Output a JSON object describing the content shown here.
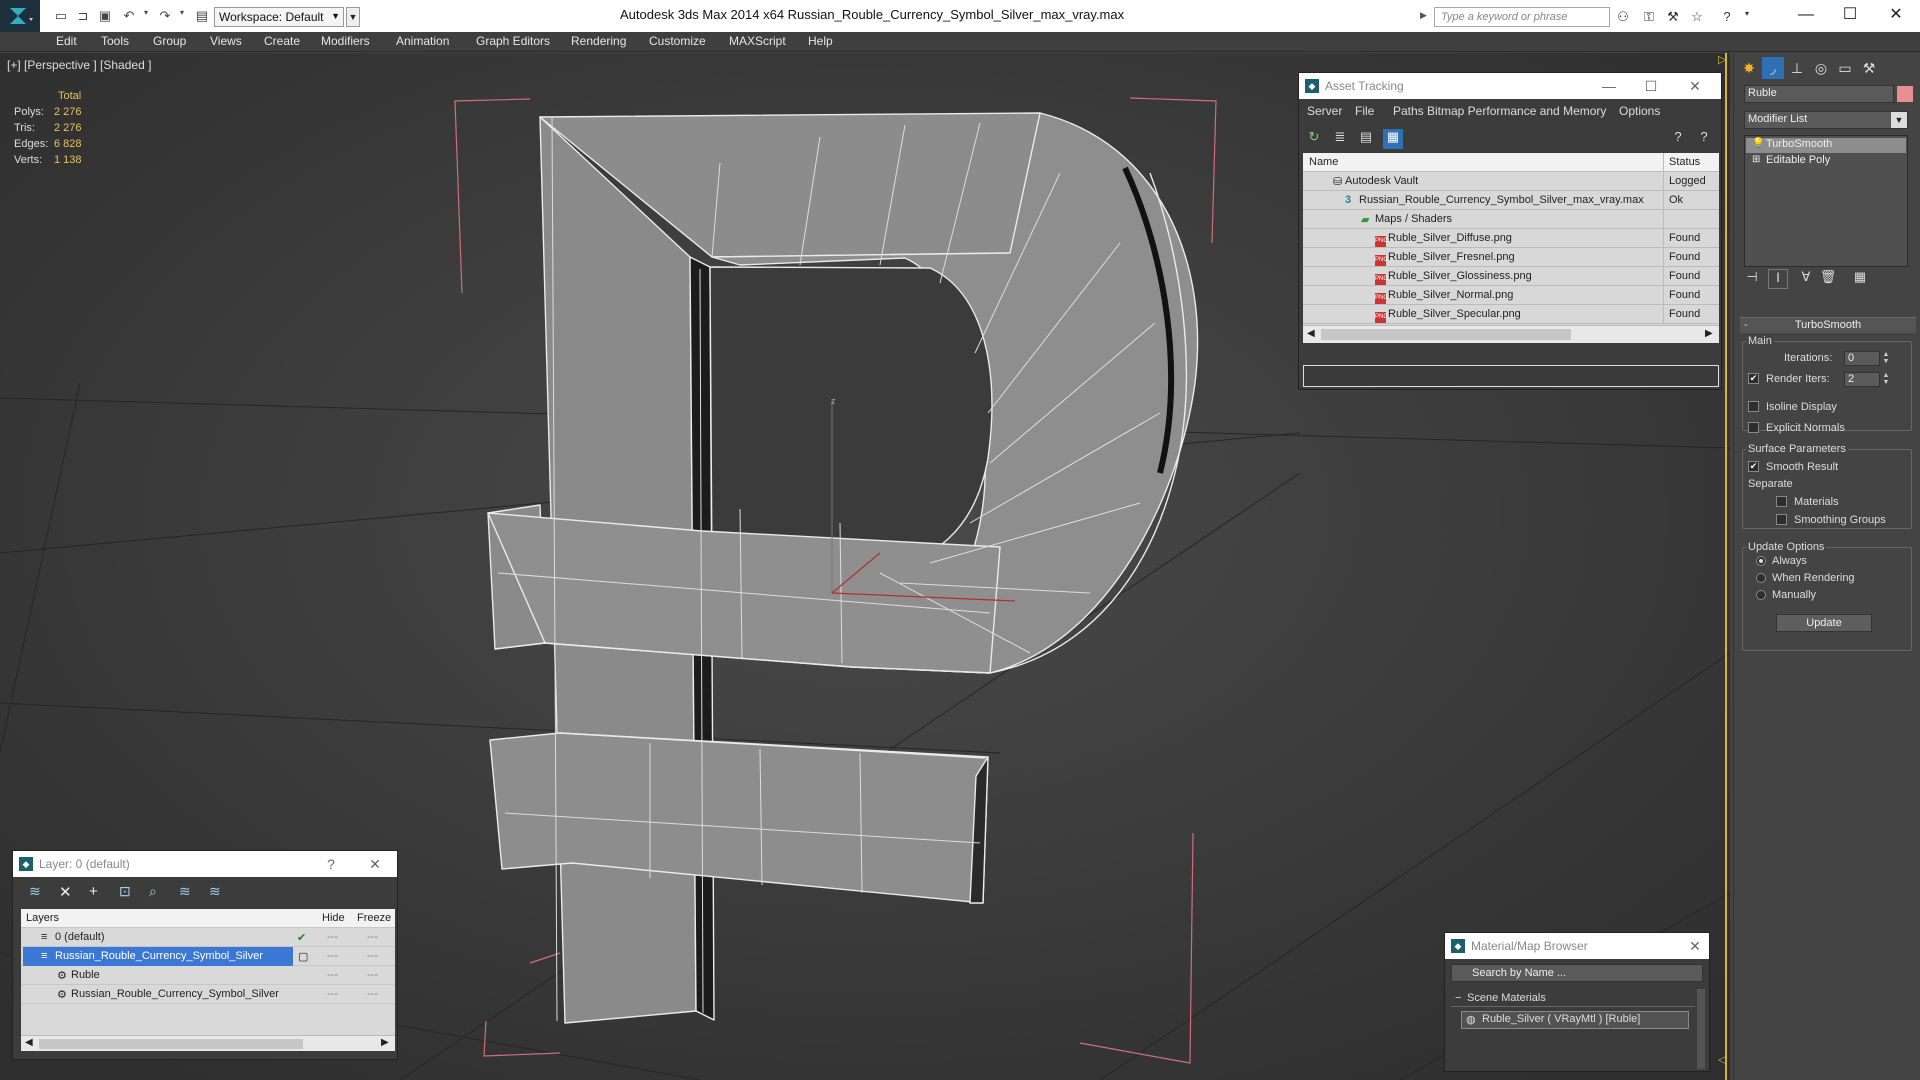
{
  "titlebar": {
    "workspace_label": "Workspace: Default",
    "app_title": "Autodesk 3ds Max  2014 x64      Russian_Rouble_Currency_Symbol_Silver_max_vray.max",
    "search_placeholder": "Type a keyword or phrase"
  },
  "menu": [
    "Edit",
    "Tools",
    "Group",
    "Views",
    "Create",
    "Modifiers",
    "Animation",
    "Graph Editors",
    "Rendering",
    "Customize",
    "MAXScript",
    "Help"
  ],
  "viewport": {
    "label": "[+] [Perspective ] [Shaded ]",
    "stats": {
      "header": "Total",
      "rows": [
        {
          "key": "Polys:",
          "value": "2 276"
        },
        {
          "key": "Tris:",
          "value": "2 276"
        },
        {
          "key": "Edges:",
          "value": "6 828"
        },
        {
          "key": "Verts:",
          "value": "1 138"
        }
      ]
    },
    "axis_label": "z"
  },
  "command_panel": {
    "object_name": "Ruble",
    "object_color": "#e98e92",
    "modifier_list": "Modifier List",
    "stack": [
      "TurboSmooth",
      "Editable Poly"
    ],
    "turbosmooth": {
      "title": "TurboSmooth",
      "main_label": "Main",
      "iterations_label": "Iterations:",
      "iterations_value": "0",
      "render_iters_label": "Render Iters:",
      "render_iters_value": "2",
      "isoline_label": "Isoline Display",
      "explicit_label": "Explicit Normals",
      "surface_label": "Surface Parameters",
      "smooth_result_label": "Smooth Result",
      "separate_label": "Separate",
      "materials_label": "Materials",
      "smoothing_groups_label": "Smoothing Groups",
      "update_options_label": "Update Options",
      "always_label": "Always",
      "when_rendering_label": "When Rendering",
      "manually_label": "Manually",
      "update_button": "Update"
    }
  },
  "asset_tracking": {
    "title": "Asset Tracking",
    "menu": [
      "Server",
      "File",
      "Paths",
      "Bitmap Performance and Memory",
      "Options"
    ],
    "col_name": "Name",
    "col_status": "Status",
    "rows": [
      {
        "name": "Autodesk Vault",
        "status": "Logged"
      },
      {
        "name": "Russian_Rouble_Currency_Symbol_Silver_max_vray.max",
        "status": "Ok"
      },
      {
        "name": "Maps / Shaders",
        "status": ""
      },
      {
        "name": "Ruble_Silver_Diffuse.png",
        "status": "Found"
      },
      {
        "name": "Ruble_Silver_Fresnel.png",
        "status": "Found"
      },
      {
        "name": "Ruble_Silver_Glossiness.png",
        "status": "Found"
      },
      {
        "name": "Ruble_Silver_Normal.png",
        "status": "Found"
      },
      {
        "name": "Ruble_Silver_Specular.png",
        "status": "Found"
      }
    ]
  },
  "layer_manager": {
    "title": "Layer: 0 (default)",
    "help": "?",
    "col_layers": "Layers",
    "col_hide": "Hide",
    "col_freeze": "Freeze",
    "rows": [
      {
        "name": "0 (default)"
      },
      {
        "name": "Russian_Rouble_Currency_Symbol_Silver"
      },
      {
        "name": "Ruble"
      },
      {
        "name": "Russian_Rouble_Currency_Symbol_Silver"
      }
    ]
  },
  "material_browser": {
    "title": "Material/Map Browser",
    "search_placeholder": "Search by Name ...",
    "section": "Scene Materials",
    "item": "Ruble_Silver  ( VRayMtl ) [Ruble]"
  }
}
